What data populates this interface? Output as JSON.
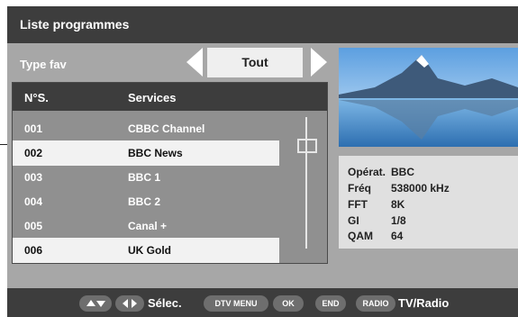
{
  "title": "Liste programmes",
  "fav": {
    "label": "Type fav",
    "value": "Tout"
  },
  "list": {
    "headers": {
      "num": "N°S.",
      "service": "Services"
    },
    "rows": [
      {
        "num": "001",
        "name": "CBBC Channel"
      },
      {
        "num": "002",
        "name": "BBC News"
      },
      {
        "num": "003",
        "name": "BBC 1"
      },
      {
        "num": "004",
        "name": "BBC 2"
      },
      {
        "num": "005",
        "name": "Canal +"
      },
      {
        "num": "006",
        "name": "UK Gold"
      }
    ],
    "selected_rows": [
      "002",
      "006"
    ]
  },
  "info": {
    "operator_label": "Opérat.",
    "operator_value": "BBC",
    "freq_label": "Fréq",
    "freq_value": "538000 kHz",
    "fft_label": "FFT",
    "fft_value": "8K",
    "gi_label": "GI",
    "gi_value": "1/8",
    "qam_label": "QAM",
    "qam_value": "64"
  },
  "bottom": {
    "select_label": "Sélec.",
    "dtv_menu": "DTV MENU",
    "ok": "OK",
    "end": "END",
    "radio": "RADIO",
    "tv_radio_label": "TV/Radio"
  },
  "icons": [
    "up-down-icon",
    "left-right-icon",
    "left-arrow-icon",
    "right-arrow-icon"
  ]
}
